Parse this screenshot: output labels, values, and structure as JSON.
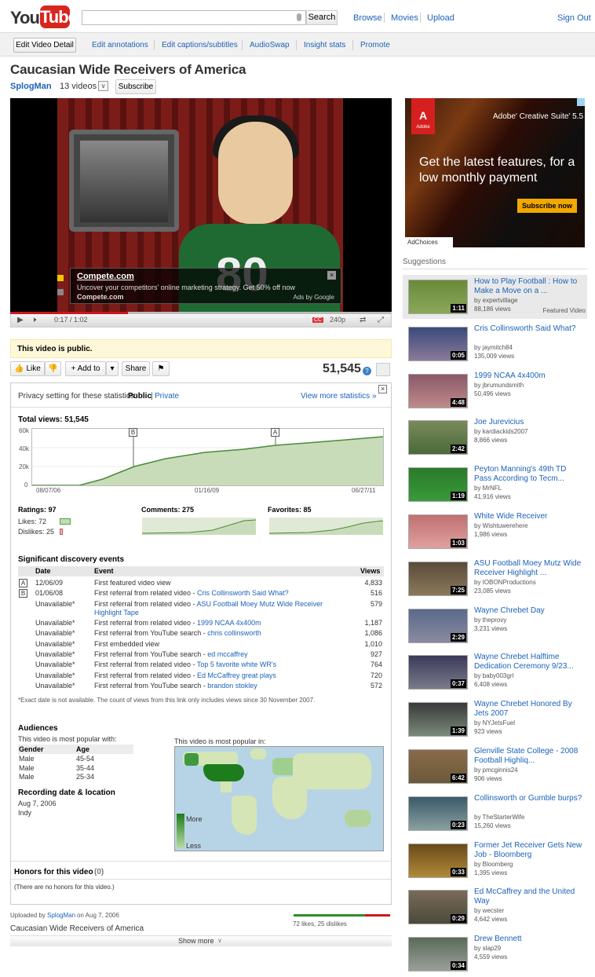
{
  "header": {
    "logo_you": "You",
    "logo_tube": "Tube",
    "search_button": "Search",
    "nav": [
      "Browse",
      "Movies",
      "Upload"
    ],
    "sign_out": "Sign Out"
  },
  "owner_bar": {
    "edit_button": "Edit Video Detail",
    "links": [
      "Edit annotations",
      "Edit captions/subtitles",
      "AudioSwap",
      "Insight stats",
      "Promote"
    ]
  },
  "video": {
    "title": "Caucasian Wide Receivers of America",
    "channel": "SplogMan",
    "video_count": "13 videos",
    "subscribe": "Subscribe",
    "overlay_ad": {
      "title": "Compete.com",
      "text": "Uncover your competitors' online marketing strategy. Get 50% off now",
      "url": "Compete.com",
      "by": "Ads by Google"
    },
    "time": "0:17 / 1:02",
    "quality": "240p",
    "cc": "CC",
    "jersey_number": "80"
  },
  "status": {
    "public": "This video is public."
  },
  "actions": {
    "like": "Like",
    "add_to": "Add to",
    "share": "Share",
    "view_count": "51,545"
  },
  "stats": {
    "privacy_label": "Privacy setting for these statistics:",
    "privacy_public": "Public",
    "privacy_private": "Private",
    "view_more": "View more statistics »",
    "total_views": "Total views: 51,545",
    "chart_data": {
      "type": "area",
      "y_ticks": [
        "60k",
        "40k",
        "20k",
        "0"
      ],
      "x_ticks": [
        "08/07/06",
        "01/16/09",
        "06/27/11"
      ],
      "markers": [
        "B",
        "A"
      ]
    },
    "ratings": "Ratings: 97",
    "likes": "Likes: 72",
    "dislikes": "Dislikes: 25",
    "comments": "Comments: 275",
    "favorites": "Favorites: 85",
    "events_heading": "Significant discovery events",
    "events_cols": [
      "Date",
      "Event",
      "Views"
    ],
    "events": [
      {
        "marker": "A",
        "date": "12/06/09",
        "event": "First featured video view",
        "link": "",
        "views": "4,833"
      },
      {
        "marker": "B",
        "date": "01/06/08",
        "event": "First referral from related video - ",
        "link": "Cris Collinsworth Said What?",
        "views": "516"
      },
      {
        "marker": "",
        "date": "Unavailable*",
        "event": "First referral from related video - ",
        "link": "ASU Football Moey Mutz Wide Receiver Highlight Tape",
        "views": "579"
      },
      {
        "marker": "",
        "date": "Unavailable*",
        "event": "First referral from related video - ",
        "link": "1999 NCAA 4x400m",
        "views": "1,187"
      },
      {
        "marker": "",
        "date": "Unavailable*",
        "event": "First referral from YouTube search - ",
        "link": "chris collinsworth",
        "views": "1,086"
      },
      {
        "marker": "",
        "date": "Unavailable*",
        "event": "First embedded view",
        "link": "",
        "views": "1,010"
      },
      {
        "marker": "",
        "date": "Unavailable*",
        "event": "First referral from YouTube search - ",
        "link": "ed mccaffrey",
        "views": "927"
      },
      {
        "marker": "",
        "date": "Unavailable*",
        "event": "First referral from related video - ",
        "link": "Top 5 favorite white WR's",
        "views": "764"
      },
      {
        "marker": "",
        "date": "Unavailable*",
        "event": "First referral from related video - ",
        "link": "Ed McCaffrey great plays",
        "views": "720"
      },
      {
        "marker": "",
        "date": "Unavailable*",
        "event": "First referral from YouTube search - ",
        "link": "brandon stokley",
        "views": "572"
      }
    ],
    "footnote": "*Exact date is not available. The count of views from this link only includes views since 30 November 2007.",
    "audiences_heading": "Audiences",
    "audiences_sub": "This video is most popular with:",
    "aud_cols": [
      "Gender",
      "Age"
    ],
    "aud_rows": [
      [
        "Male",
        "45-54"
      ],
      [
        "Male",
        "35-44"
      ],
      [
        "Male",
        "25-34"
      ]
    ],
    "recording_heading": "Recording date & location",
    "recording_date": "Aug 7, 2006",
    "recording_place": "Indy",
    "map_heading": "This video is most popular in:",
    "map_more": "More",
    "map_less": "Less",
    "honors_heading": "Honors for this video",
    "honors_count": "(0)",
    "honors_text": "(There are no honors for this video.)"
  },
  "footer": {
    "uploaded_by": "Uploaded by",
    "uploader": "SplogMan",
    "uploaded_on": "on Aug 7, 2006",
    "description": "Caucasian Wide Receivers of America",
    "likes_text": "72 likes, 25 dislikes",
    "show_more": "Show more"
  },
  "ad": {
    "brand": "Adobe",
    "product": "Adobe' Creative Suite' 5.5",
    "headline": "Get the latest features, for a low monthly payment",
    "button": "Subscribe now",
    "adchoices": "AdChoices"
  },
  "suggestions": {
    "heading": "Suggestions",
    "featured_tag": "Featured Video",
    "items": [
      {
        "title": "How to Play Football : How to Make a Move on a ...",
        "by": "by expertvillage",
        "views": "88,186 views",
        "dur": "1:11"
      },
      {
        "title": "Cris Collinsworth Said What?",
        "by": "by jaymitch84",
        "views": "135,009 views",
        "dur": "0:05"
      },
      {
        "title": "1999 NCAA 4x400m",
        "by": "by jbrumundsmith",
        "views": "50,496 views",
        "dur": "4:48"
      },
      {
        "title": "Joe Jurevicius",
        "by": "by kardiackids2007",
        "views": "8,866 views",
        "dur": "2:42"
      },
      {
        "title": "Peyton Manning's 49th TD Pass According to Tecm...",
        "by": "by MrNFL",
        "views": "41,916 views",
        "dur": "1:19"
      },
      {
        "title": "White Wide Receiver",
        "by": "by Wishtuwerehere",
        "views": "1,986 views",
        "dur": "1:03"
      },
      {
        "title": "ASU Football Moey Mutz Wide Receiver Highlight ...",
        "by": "by IOBONProductions",
        "views": "23,085 views",
        "dur": "7:25"
      },
      {
        "title": "Wayne Chrebet Day",
        "by": "by theprovy",
        "views": "3,231 views",
        "dur": "2:29"
      },
      {
        "title": "Wayne Chrebet Halftime Dedication Ceremony 9/23...",
        "by": "by baby003grl",
        "views": "6,408 views",
        "dur": "0:37"
      },
      {
        "title": "Wayne Chrebet Honored By Jets 2007",
        "by": "by NYJetsFuel",
        "views": "923 views",
        "dur": "1:39"
      },
      {
        "title": "Glenville State College - 2008 Football Highliq...",
        "by": "by pmcginnis24",
        "views": "906 views",
        "dur": "6:42"
      },
      {
        "title": "Collinsworth or Gumble burps?",
        "by": "by TheStarterWife",
        "views": "15,260 views",
        "dur": "0:23"
      },
      {
        "title": "Former Jet Receiver Gets New Job - Bloomberg",
        "by": "by Bloomberg",
        "views": "1,395 views",
        "dur": "0:33"
      },
      {
        "title": "Ed McCaffrey and the United Way",
        "by": "by wecster",
        "views": "4,642 views",
        "dur": "0:29"
      },
      {
        "title": "Drew Bennett",
        "by": "by slap29",
        "views": "4,559 views",
        "dur": "0:34"
      }
    ]
  },
  "colors": {
    "brand_red": "#d8261f",
    "link_blue": "#1c62b9",
    "chart_green": "#c9dcb9",
    "chart_line": "#4a8a3a"
  }
}
